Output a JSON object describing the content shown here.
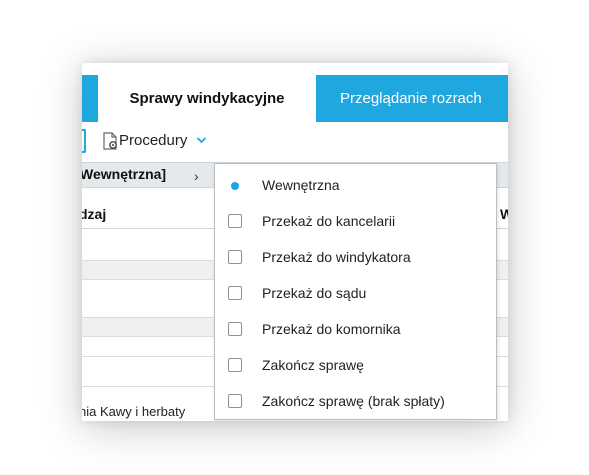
{
  "tabs": {
    "active_label": "Sprawy windykacyjne",
    "inactive_label": "Przeglądanie rozrach"
  },
  "toolbar": {
    "procedury_label": "Procedury",
    "procedury_icon": "document-gear-icon",
    "dropdown_icon": "chevron-down-icon"
  },
  "breadcrumb": {
    "text": "Wewnętrzna]",
    "chevron": "›"
  },
  "grid": {
    "header_rodzaj": "dzaj",
    "header_w": "W",
    "last_row_text": "nia Kawy i herbaty"
  },
  "menu": {
    "items": [
      {
        "label": "Wewnętrzna",
        "selected": true
      },
      {
        "label": "Przekaż do kancelarii",
        "selected": false
      },
      {
        "label": "Przekaż do windykatora",
        "selected": false
      },
      {
        "label": "Przekaż do sądu",
        "selected": false
      },
      {
        "label": "Przekaż do komornika",
        "selected": false
      },
      {
        "label": "Zakończ sprawę",
        "selected": false
      },
      {
        "label": "Zakończ sprawę (brak spłaty)",
        "selected": false
      }
    ]
  },
  "colors": {
    "accent": "#1fa7e0",
    "row_alt": "#eef0f2",
    "breadcrumb_bg": "#e6e9ec"
  }
}
